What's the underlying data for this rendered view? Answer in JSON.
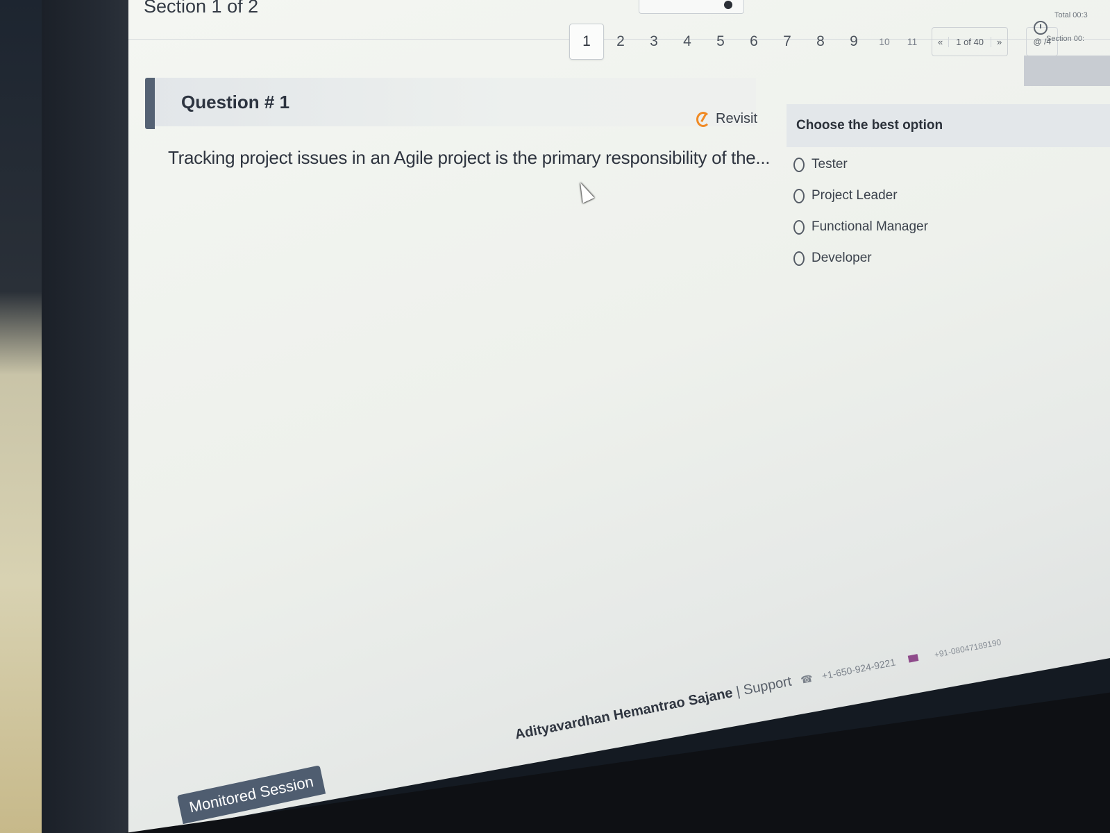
{
  "header": {
    "section_label": "Section 1 of 2"
  },
  "pagination": {
    "pages": [
      "1",
      "2",
      "3",
      "4",
      "5",
      "6",
      "7",
      "8",
      "9",
      "10",
      "11"
    ],
    "active_page": "1",
    "prev_symbol": "«",
    "range_text": "1 of 40",
    "next_symbol": "»",
    "zoom_text": "@ /4"
  },
  "timer": {
    "line1": "Total 00:3",
    "line2": "Section 00:"
  },
  "question": {
    "title": "Question # 1",
    "revisit_label": "Revisit",
    "text": "Tracking project issues in an Agile project is the primary responsibility of the..."
  },
  "options": {
    "heading": "Choose the best option",
    "items": [
      "Tester",
      "Project Leader",
      "Functional Manager",
      "Developer"
    ]
  },
  "footer": {
    "candidate_name": "Adityavardhan Hemantrao Sajane",
    "separator": "|",
    "support_label": "Support",
    "phone_us": "+1-650-924-9221",
    "phone_in": "+91-08047189190"
  },
  "badge": {
    "label": "Monitored Session"
  },
  "colors": {
    "accent_bar": "#556274",
    "revisit_icon": "#f08a24",
    "badge_bg": "#4f5d70"
  },
  "icons": [
    "revisit-icon",
    "clock-icon",
    "phone-icon",
    "flag-icon",
    "mouse-cursor-icon"
  ]
}
